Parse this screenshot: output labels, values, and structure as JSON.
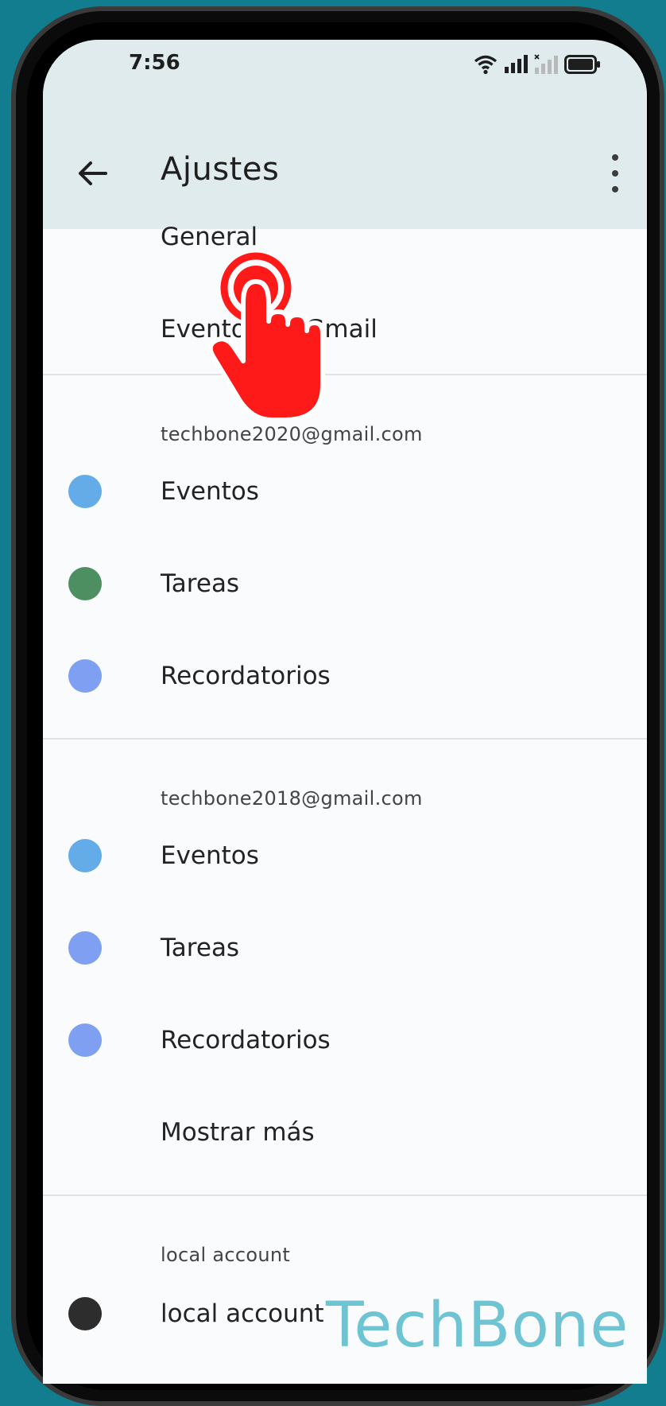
{
  "status_bar": {
    "time": "7:56",
    "icons": [
      "wifi-icon",
      "signal-icon",
      "signal-no-sim-icon",
      "battery-icon"
    ]
  },
  "app_bar": {
    "title": "Ajustes",
    "back_icon": "arrow-left-icon",
    "menu_icon": "more-vert-icon"
  },
  "top_items": [
    {
      "label": "General"
    },
    {
      "label": "Eventos de Gmail"
    }
  ],
  "accounts": [
    {
      "email": "techbone2020@gmail.com",
      "calendars": [
        {
          "label": "Eventos",
          "color": "#63ace8"
        },
        {
          "label": "Tareas",
          "color": "#4e8f62"
        },
        {
          "label": "Recordatorios",
          "color": "#7f9ff2"
        }
      ]
    },
    {
      "email": "techbone2018@gmail.com",
      "calendars": [
        {
          "label": "Eventos",
          "color": "#63ace8"
        },
        {
          "label": "Tareas",
          "color": "#7f9ff2"
        },
        {
          "label": "Recordatorios",
          "color": "#7f9ff2"
        }
      ],
      "show_more": "Mostrar más"
    },
    {
      "email": "local account",
      "calendars": [
        {
          "label": "local account",
          "color": "#2d2d2d"
        }
      ]
    }
  ],
  "watermark": "TechBone",
  "colors": {
    "background": "#117d8e",
    "app_bar": "#e0ebee",
    "screen": "#f9fbfc",
    "touch_indicator": "#ff1a1a"
  }
}
